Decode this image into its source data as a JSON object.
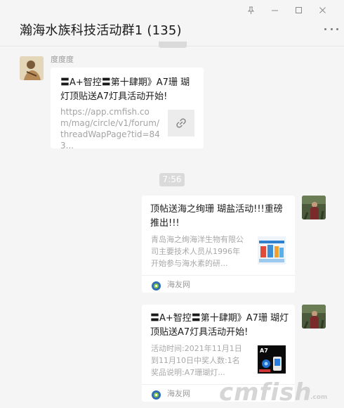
{
  "chat": {
    "title": "瀚海水族科技活动群1 (135)",
    "time_divider": "7:56"
  },
  "messages": {
    "first": {
      "sender": "度度度",
      "title": "〓A+智控〓第十肆期》A7珊 瑚灯顶贴送A7灯具活动开始!",
      "url": "https://app.cmfish.com/mag/circle/v1/forum/threadWapPage?tid=843..."
    },
    "second": {
      "title": "顶帖送海之绚珊 瑚盐活动!!!重磅推出!!!",
      "desc": "青岛海之绚海洋生物有限公司主要技术人员从1996年开始参与海水素的研...",
      "source": "海友网"
    },
    "third": {
      "title": "〓A+智控〓第十肆期》A7珊 瑚灯顶贴送A7灯具活动开始!",
      "desc": "活动时间:2021年11月1日到11月10日中奖人数:1名奖品说明:A7珊瑚灯...",
      "source": "海友网",
      "thumb_label": "A7"
    }
  },
  "watermark": {
    "text": "cmfish",
    "domain": ".com"
  },
  "icons": [
    "pin-icon",
    "minimize-icon",
    "maximize-icon",
    "close-icon",
    "more-icon",
    "link-icon",
    "source-icon"
  ],
  "colors": {
    "background": "#f5f5f5",
    "card": "#ffffff",
    "muted_text": "#a8a8a8",
    "time_pill": "#dadada"
  }
}
